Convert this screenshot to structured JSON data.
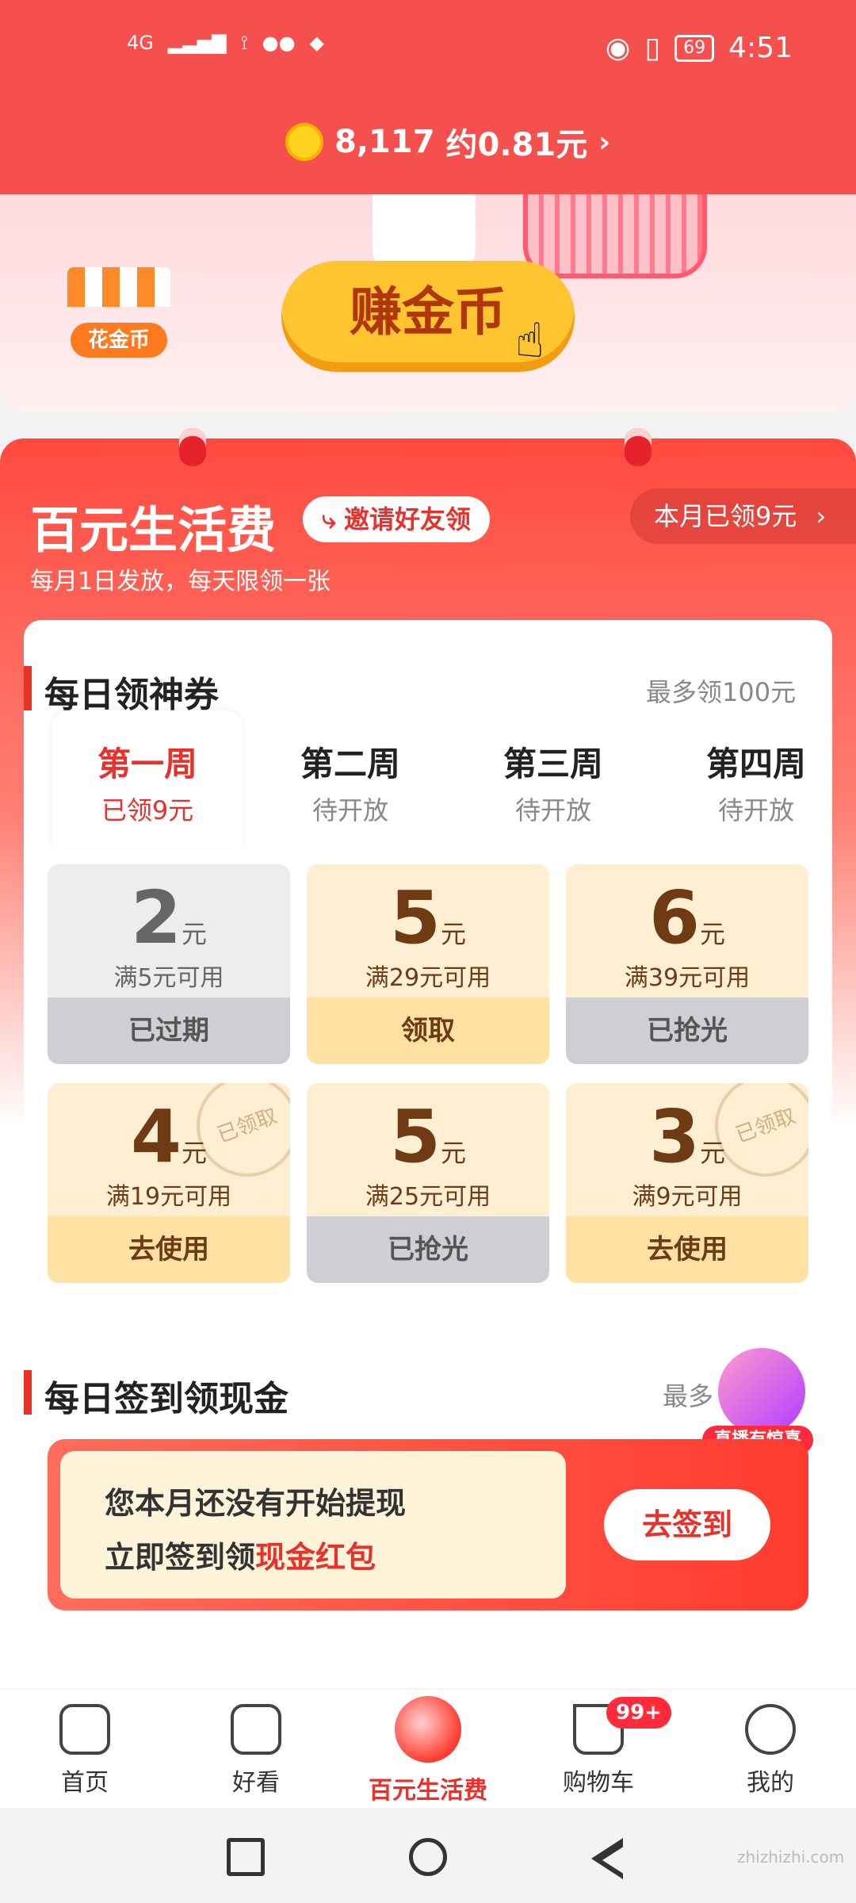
{
  "status_bar": {
    "network": "4G",
    "time": "4:51",
    "battery": "69"
  },
  "header": {
    "coins": "8,117",
    "approx": "约0.81元",
    "chevron": "›"
  },
  "banner": {
    "shop_label": "花金币",
    "earn_button": "赚金币"
  },
  "living": {
    "title": "百元生活费",
    "invite_label": "邀请好友领",
    "month_pill": "本月已领9元",
    "month_pill_chevron": "›",
    "subtitle": "每月1日发放，每天限领一张"
  },
  "daily_coupon": {
    "title": "每日领神券",
    "max_note": "最多领100元",
    "tabs": [
      {
        "week": "第一周",
        "status": "已领9元"
      },
      {
        "week": "第二周",
        "status": "待开放"
      },
      {
        "week": "第三周",
        "status": "待开放"
      },
      {
        "week": "第四周",
        "status": "待开放"
      }
    ],
    "coupons": [
      {
        "amount": "2",
        "unit": "元",
        "cond": "满5元可用",
        "action": "已过期"
      },
      {
        "amount": "5",
        "unit": "元",
        "cond": "满29元可用",
        "action": "领取"
      },
      {
        "amount": "6",
        "unit": "元",
        "cond": "满39元可用",
        "action": "已抢光"
      },
      {
        "amount": "4",
        "unit": "元",
        "cond": "满19元可用",
        "action": "去使用",
        "stamp": "已领取"
      },
      {
        "amount": "5",
        "unit": "元",
        "cond": "满25元可用",
        "action": "已抢光"
      },
      {
        "amount": "3",
        "unit": "元",
        "cond": "满9元可用",
        "action": "去使用",
        "stamp": "已领取"
      }
    ]
  },
  "checkin": {
    "title": "每日签到领现金",
    "max_note": "最多",
    "line1": "您本月还没有开始提现",
    "line2_prefix": "立即签到领",
    "line2_highlight": "现金红包",
    "button": "去签到",
    "live_badge": "直播有惊喜"
  },
  "bottom_nav": {
    "items": [
      {
        "label": "首页",
        "icon": "home-icon"
      },
      {
        "label": "好看",
        "icon": "video-icon"
      },
      {
        "label": "百元生活费",
        "icon": "red-envelope-icon"
      },
      {
        "label": "购物车",
        "icon": "cart-icon"
      },
      {
        "label": "我的",
        "icon": "profile-icon"
      }
    ],
    "cart_badge": "99+"
  },
  "watermark": "zhizhizhi.com",
  "colors": {
    "brand_red": "#f6504e",
    "accent_red": "#e6322b",
    "coupon_bg": "#feefd2",
    "coin_gold": "#ffd21e"
  }
}
